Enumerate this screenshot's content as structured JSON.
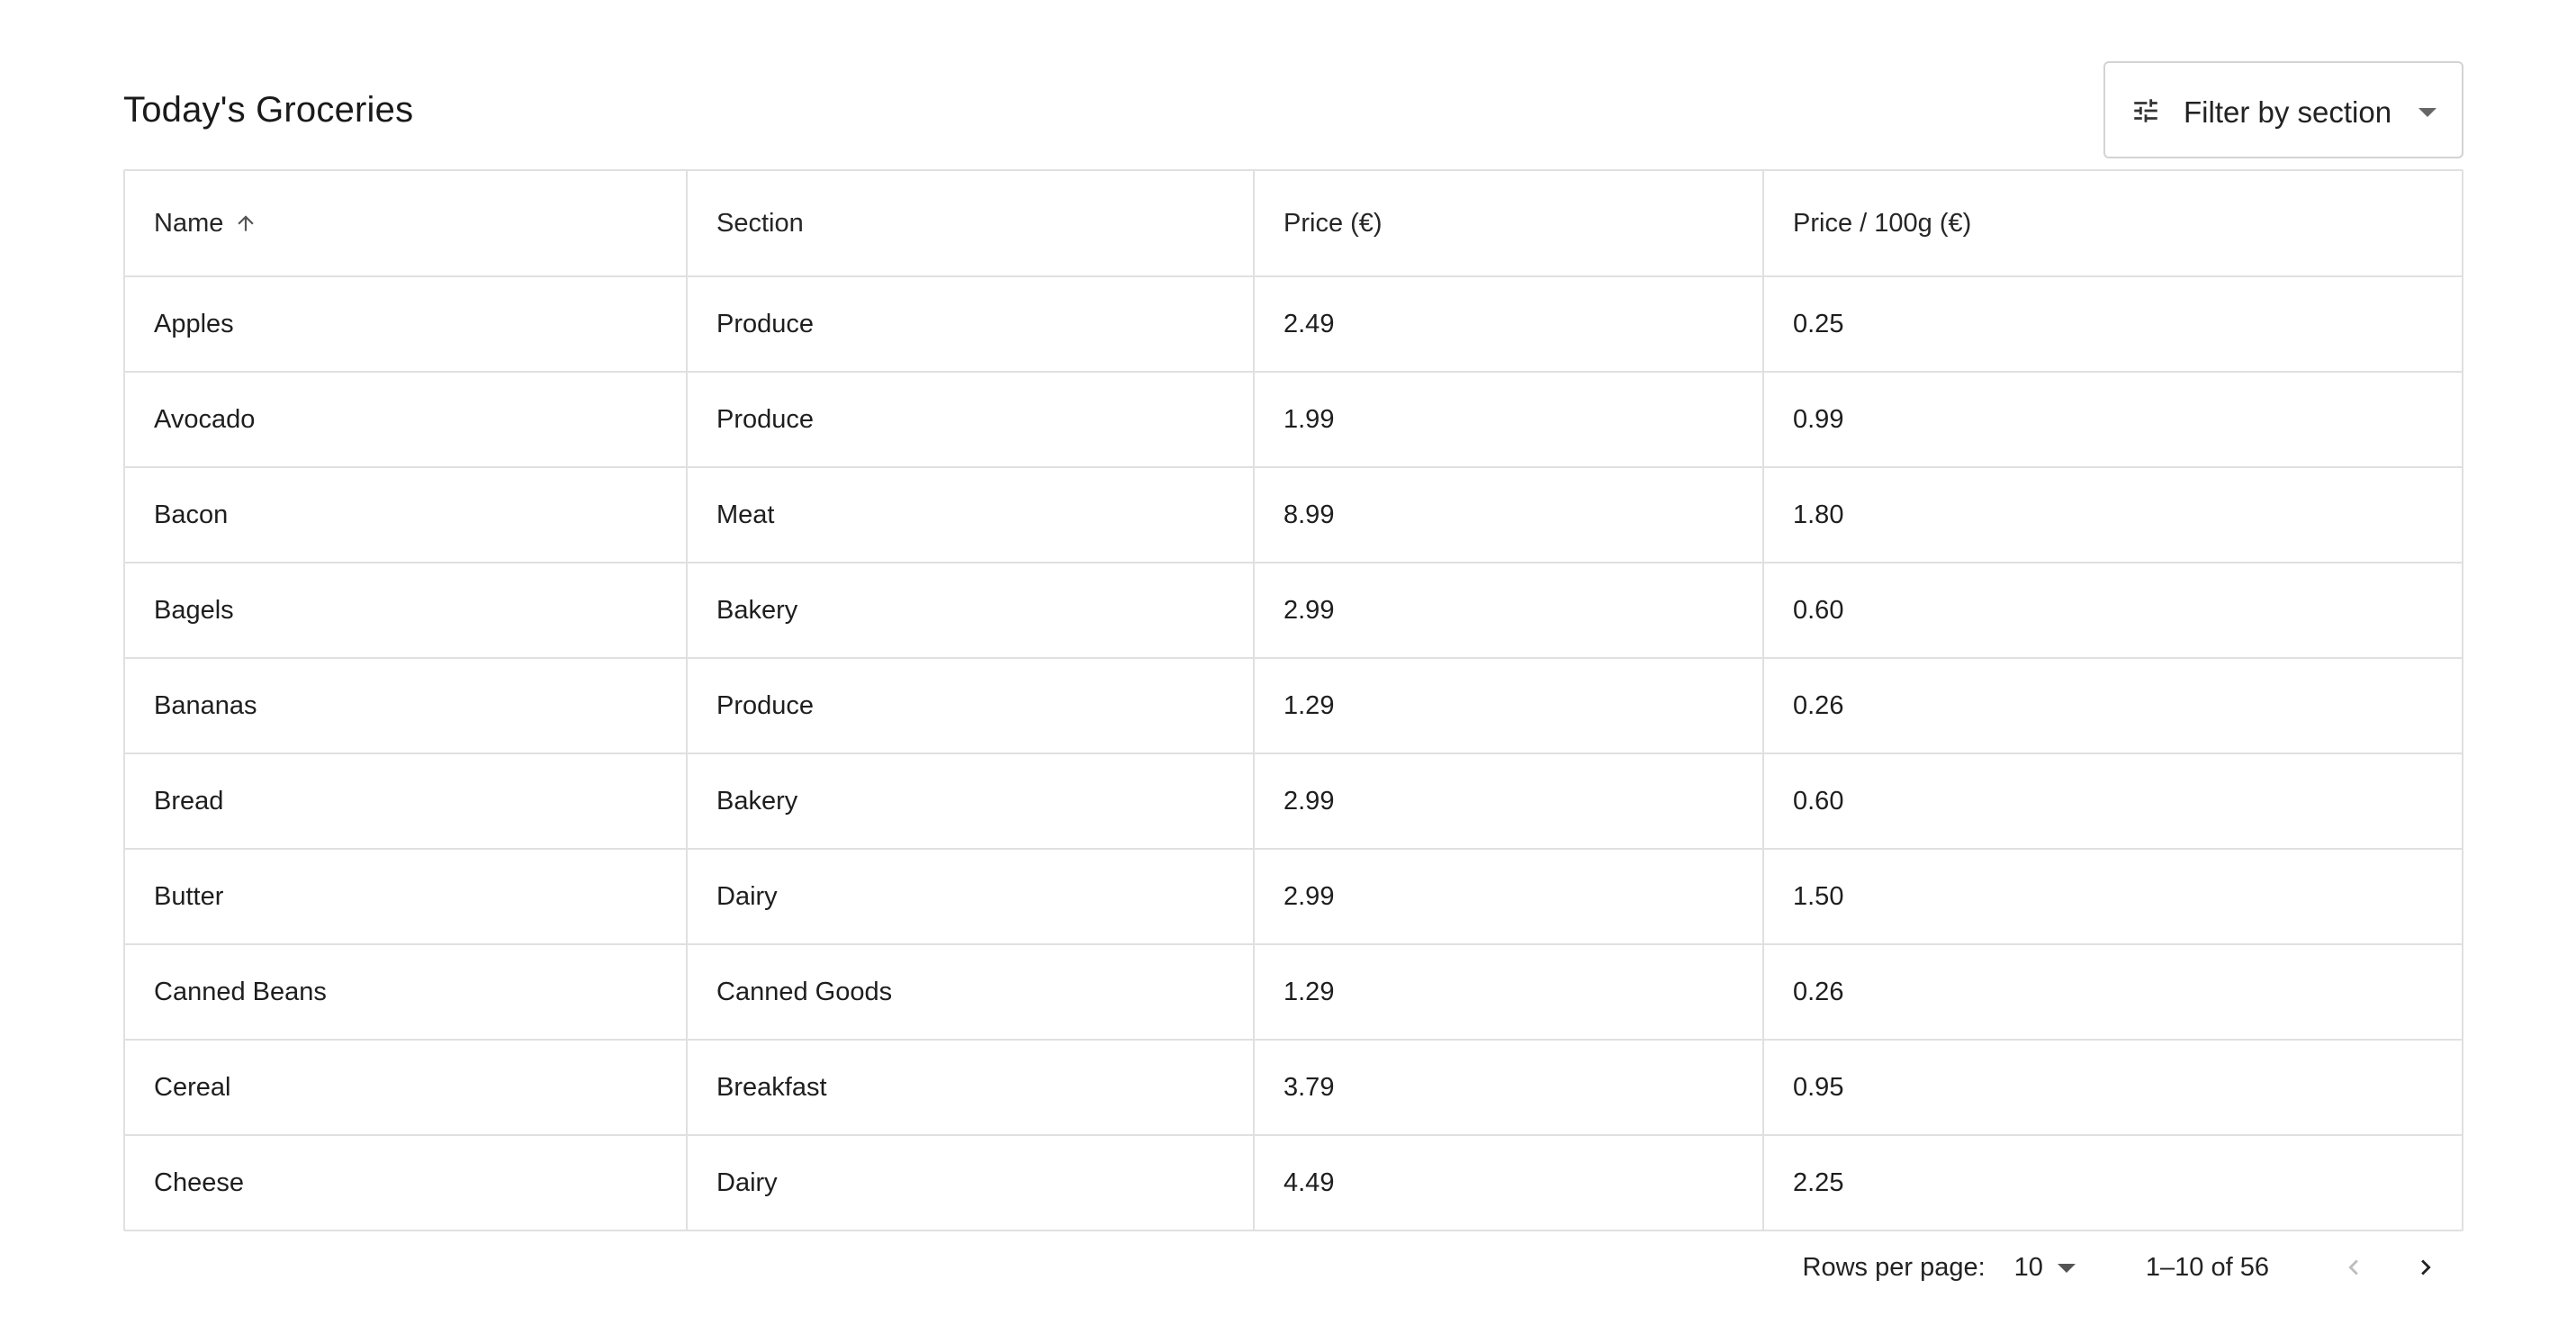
{
  "title": "Today's Groceries",
  "filter": {
    "label": "Filter by section",
    "icon": "tune-sliders-icon"
  },
  "table": {
    "columns": [
      {
        "label": "Name",
        "sorted": "ascending"
      },
      {
        "label": "Section"
      },
      {
        "label": "Price (€)"
      },
      {
        "label": "Price / 100g (€)"
      }
    ],
    "rows": [
      [
        "Apples",
        "Produce",
        "2.49",
        "0.25"
      ],
      [
        "Avocado",
        "Produce",
        "1.99",
        "0.99"
      ],
      [
        "Bacon",
        "Meat",
        "8.99",
        "1.80"
      ],
      [
        "Bagels",
        "Bakery",
        "2.99",
        "0.60"
      ],
      [
        "Bananas",
        "Produce",
        "1.29",
        "0.26"
      ],
      [
        "Bread",
        "Bakery",
        "2.99",
        "0.60"
      ],
      [
        "Butter",
        "Dairy",
        "2.99",
        "1.50"
      ],
      [
        "Canned Beans",
        "Canned Goods",
        "1.29",
        "0.26"
      ],
      [
        "Cereal",
        "Breakfast",
        "3.79",
        "0.95"
      ],
      [
        "Cheese",
        "Dairy",
        "4.49",
        "2.25"
      ]
    ]
  },
  "pagination": {
    "rows_per_page_label": "Rows per page:",
    "rows_per_page_value": "10",
    "range_text": "1–10 of 56",
    "prev_enabled": false,
    "next_enabled": true
  },
  "colors": {
    "border": "#e0e0e0",
    "text": "#1e1e1e",
    "disabled_icon": "#bdbdbd"
  }
}
